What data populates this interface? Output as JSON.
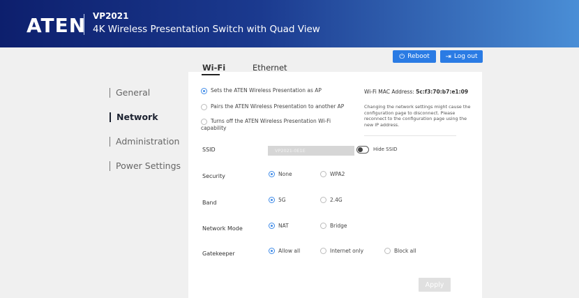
{
  "header": {
    "logo": "ATEN",
    "model": "VP2021",
    "subtitle": "4K Wireless Presentation Switch with Quad View"
  },
  "toolbar": {
    "reboot_icon": "power-icon",
    "reboot_label": "Reboot",
    "logout_icon": "logout-icon",
    "logout_label": "Log out"
  },
  "tabs": [
    {
      "label": "Wi-Fi",
      "active": true
    },
    {
      "label": "Ethernet",
      "active": false
    }
  ],
  "sidebar": {
    "items": [
      {
        "label": "General",
        "active": false
      },
      {
        "label": "Network",
        "active": true
      },
      {
        "label": "Administration",
        "active": false
      },
      {
        "label": "Power Settings",
        "active": false
      }
    ]
  },
  "ap_mode": {
    "options": [
      {
        "label": "Sets the ATEN Wireless Presentation as AP",
        "selected": true
      },
      {
        "label": "Pairs the ATEN Wireless Presentation to another AP",
        "selected": false
      },
      {
        "label": "Turns off the ATEN Wireless Presentation Wi-Fi capability",
        "selected": false
      }
    ]
  },
  "mac": {
    "label": "Wi-Fi MAC Address:",
    "value": "5c:f3:70:b7:e1:09"
  },
  "note": "Changing the network settings might cause the configuration page to disconnect. Please reconnect to the configuration page using the new IP address.",
  "ssid": {
    "label": "SSID",
    "value": "VP2021-0E1E",
    "hide_label": "Hide SSID"
  },
  "security": {
    "label": "Security",
    "options": [
      "None",
      "WPA2"
    ],
    "selected": "None"
  },
  "band": {
    "label": "Band",
    "options": [
      "5G",
      "2.4G"
    ],
    "selected": "5G"
  },
  "network_mode": {
    "label": "Network Mode",
    "options": [
      "NAT",
      "Bridge"
    ],
    "selected": "NAT"
  },
  "gatekeeper": {
    "label": "Gatekeeper",
    "options": [
      "Allow all",
      "Internet only",
      "Block all"
    ],
    "selected": "Allow all"
  },
  "apply_label": "Apply",
  "colors": {
    "header_start": "#0d1f6d",
    "header_end": "#4a8ed6",
    "accent": "#2a7be4"
  }
}
